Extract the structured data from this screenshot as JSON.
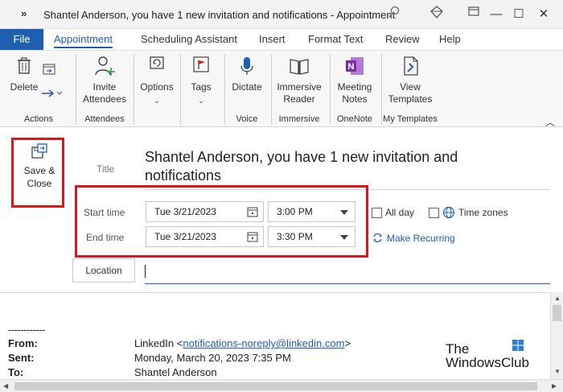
{
  "titlebar": {
    "menu_glyph": "»",
    "title": "Shantel Anderson, you have 1 new invitation and notifications  -  Appointment",
    "icons": [
      "search-icon",
      "diamond-icon",
      "ribbon-display-icon"
    ],
    "window_controls": [
      "—",
      "☐",
      "✕"
    ]
  },
  "tabs": {
    "file": "File",
    "items": [
      "Appointment",
      "Scheduling Assistant",
      "Insert",
      "Format Text",
      "Review",
      "Help"
    ],
    "active": "Appointment"
  },
  "ribbon": {
    "delete": "Delete",
    "invite": "Invite",
    "attendees": "Attendees",
    "options": "Options",
    "tags": "Tags",
    "dictate": "Dictate",
    "immersive": "Immersive",
    "reader": "Reader",
    "meeting": "Meeting",
    "notes": "Notes",
    "view": "View",
    "templates": "Templates",
    "groups": [
      "Actions",
      "Attendees",
      "Voice",
      "Immersive",
      "OneNote",
      "My Templates"
    ],
    "collapse_glyph": "︿"
  },
  "form": {
    "save_close_1": "Save &",
    "save_close_2": "Close",
    "title_label": "Title",
    "subject": "Shantel Anderson, you have 1 new invitation and notifications",
    "start_label": "Start time",
    "end_label": "End time",
    "start_date": "Tue 3/21/2023",
    "start_time": "3:00 PM",
    "end_date": "Tue 3/21/2023",
    "end_time": "3:30 PM",
    "all_day": "All day",
    "time_zones": "Time zones",
    "make_recurring": "Make Recurring",
    "location": "Location"
  },
  "message": {
    "separator": "------------",
    "from_label": "From:",
    "from_name": "LinkedIn <",
    "from_email": "notifications-noreply@linkedin.com",
    "from_close": ">",
    "sent_label": "Sent:",
    "sent_value": "Monday, March 20, 2023 7:35 PM",
    "to_label": "To:",
    "to_value": "Shantel Anderson"
  },
  "watermark": {
    "line1": "The",
    "line2": "WindowsClub"
  },
  "colors": {
    "accent": "#1f5fb0",
    "highlight": "#e0151b"
  }
}
